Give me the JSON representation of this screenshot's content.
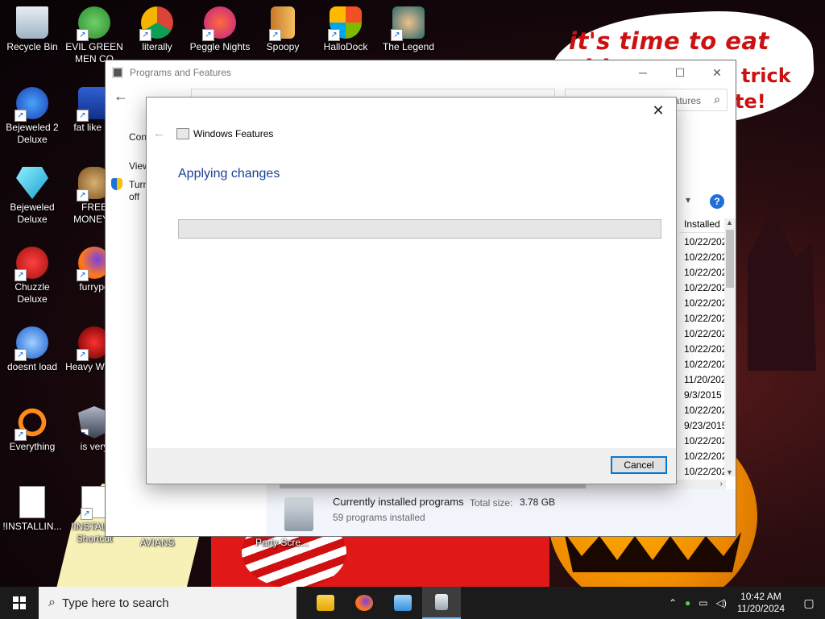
{
  "wallpaper": {
    "speech_bubble": "it's time to eat shit",
    "speech_bubble_frag1": "trick",
    "speech_bubble_frag2": "te!"
  },
  "desktop_icons": [
    {
      "label": "Recycle Bin"
    },
    {
      "label": "EVIL GREEN MEN CO"
    },
    {
      "label": "literally"
    },
    {
      "label": "Peggle Nights"
    },
    {
      "label": "Spoopy"
    },
    {
      "label": "HalloDock"
    },
    {
      "label": "The Legend"
    },
    {
      "label": "Bejeweled 2 Deluxe"
    },
    {
      "label": "fat like da"
    },
    {
      "label": "Bejeweled Deluxe"
    },
    {
      "label": "FREE MONEY.c"
    },
    {
      "label": "Chuzzle Deluxe"
    },
    {
      "label": "furrypo"
    },
    {
      "label": "doesnt load"
    },
    {
      "label": "Heavy Weap."
    },
    {
      "label": "Everything"
    },
    {
      "label": "is very"
    },
    {
      "label": "!INSTALLIN..."
    },
    {
      "label": "!INSTALL - Shortcut"
    },
    {
      "label": "AVIANS"
    },
    {
      "label": "Party Scre..."
    }
  ],
  "programs_window": {
    "title": "Programs and Features",
    "search_placeholder": "atures",
    "side_links": [
      "Cont",
      "View",
      "Turn",
      "off"
    ],
    "column_header": "Installed",
    "install_dates": [
      "10/22/202",
      "10/22/202",
      "10/22/202",
      "10/22/202",
      "10/22/202",
      "10/22/202",
      "10/22/202",
      "10/22/202",
      "10/22/202",
      "11/20/202",
      "9/3/2015",
      "10/22/202",
      "9/23/2015",
      "10/22/202",
      "10/22/202",
      "10/22/202"
    ],
    "status": {
      "currently_installed": "Currently installed programs",
      "total_size_label": "Total size:",
      "total_size_value": "3.78 GB",
      "count": "59 programs installed"
    }
  },
  "features_dialog": {
    "title": "Windows Features",
    "heading": "Applying changes",
    "progress": 0,
    "cancel_label": "Cancel",
    "colors": {
      "heading": "#1c3f94",
      "accent": "#0078d7"
    }
  },
  "taskbar": {
    "search_placeholder": "Type here to search",
    "time": "10:42 AM",
    "date": "11/20/2024"
  }
}
